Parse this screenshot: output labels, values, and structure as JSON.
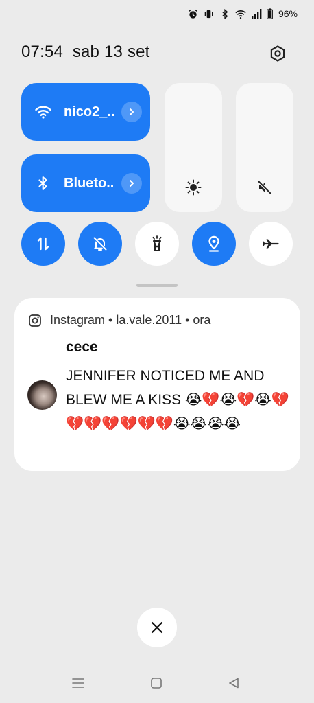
{
  "status_bar": {
    "battery_percent": "96%",
    "icons": [
      "alarm-icon",
      "vibrate-icon",
      "bluetooth-icon",
      "wifi-icon",
      "signal-icon",
      "battery-icon"
    ]
  },
  "header": {
    "time": "07:54",
    "date": "sab 13 set"
  },
  "quick_tiles": {
    "wifi": {
      "label": "nico2_..",
      "icon": "wifi-icon",
      "active": true
    },
    "bluetooth": {
      "label": "Blueto..",
      "icon": "bluetooth-icon",
      "active": true
    }
  },
  "sliders": {
    "brightness": {
      "icon": "brightness-icon"
    },
    "volume": {
      "icon": "volume-muted-icon"
    }
  },
  "toggles": [
    {
      "name": "mobile-data",
      "icon": "data-arrows-icon",
      "active": true
    },
    {
      "name": "do-not-disturb",
      "icon": "bell-off-icon",
      "active": true
    },
    {
      "name": "flashlight",
      "icon": "flashlight-icon",
      "active": false
    },
    {
      "name": "location",
      "icon": "location-icon",
      "active": true
    },
    {
      "name": "airplane-mode",
      "icon": "airplane-icon",
      "active": false
    }
  ],
  "notification": {
    "app": "Instagram",
    "account": "la.vale.2011",
    "time": "ora",
    "header_text": "Instagram • la.vale.2011 • ora",
    "title": "cece",
    "message": "JENNIFER NOTICED ME AND BLEW ME A KISS 😭💔😭💔😭💔💔💔💔💔💔💔😭😭😭😭"
  },
  "colors": {
    "accent": "#1e7bf5",
    "background": "#ebebeb",
    "tile_off": "#ffffff"
  }
}
